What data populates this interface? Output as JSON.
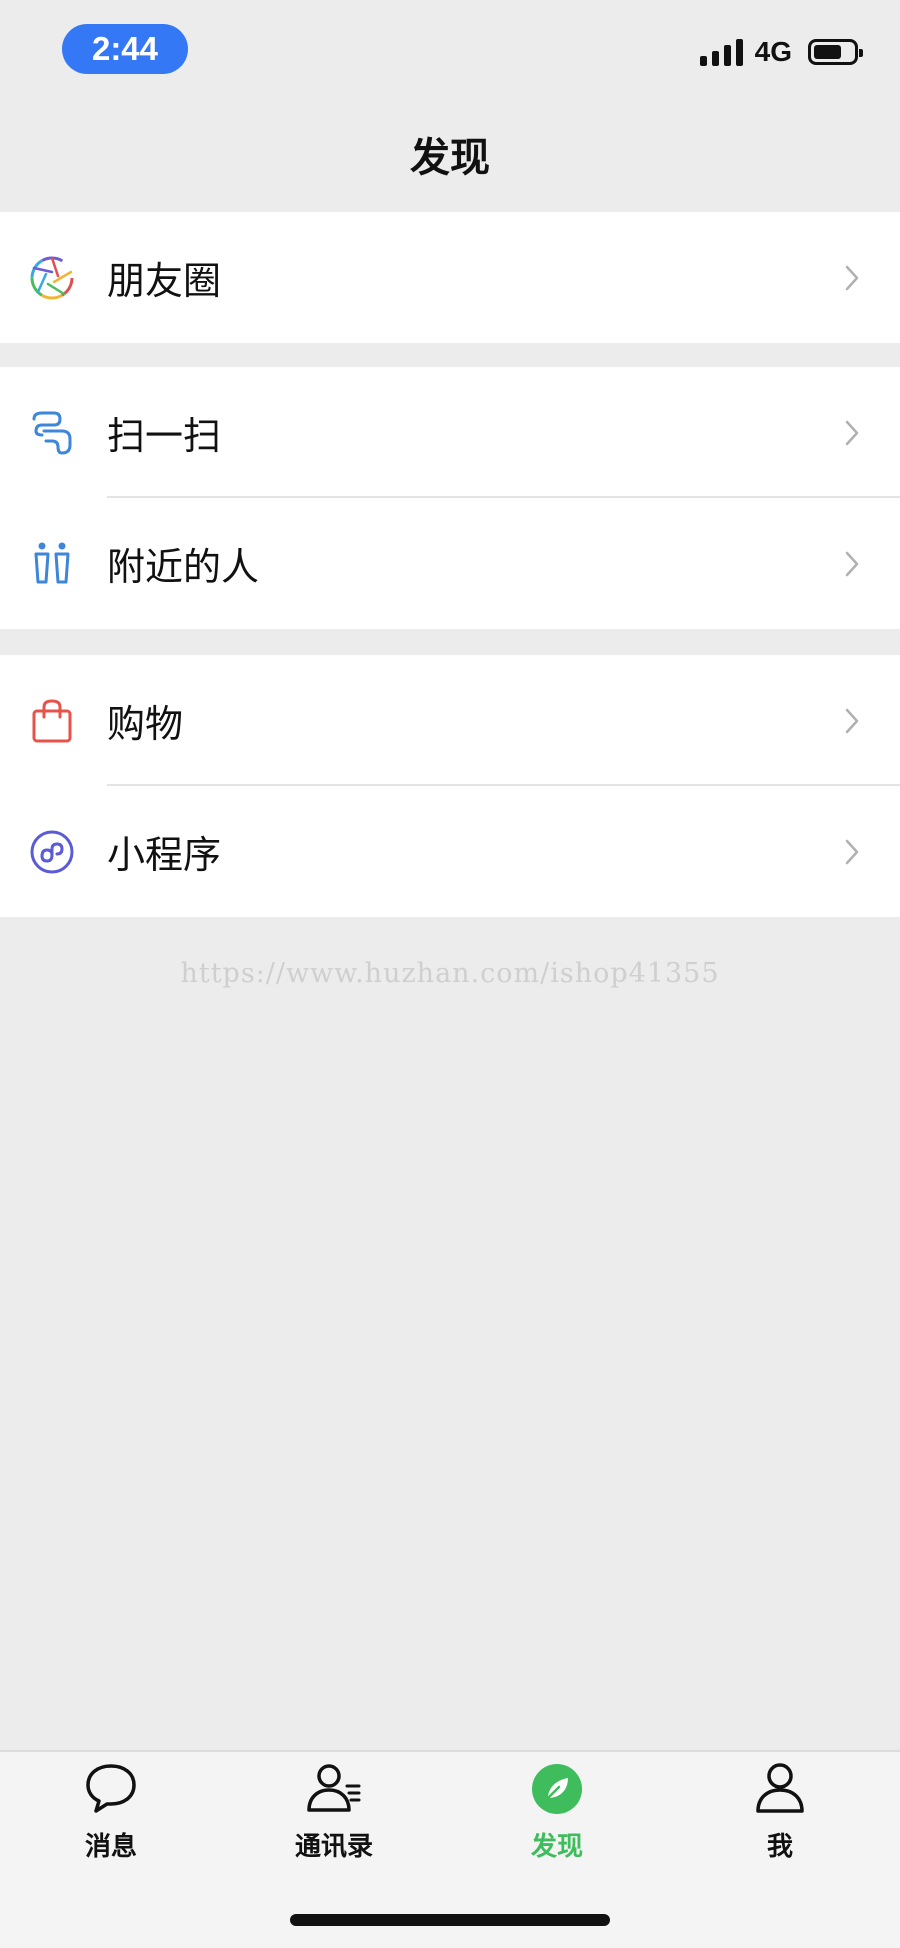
{
  "status": {
    "time": "2:44",
    "network": "4G",
    "battery_level": 0.7
  },
  "header": {
    "title": "发现"
  },
  "groups": [
    {
      "items": [
        {
          "label": "朋友圈",
          "icon": "moments-aperture-icon"
        }
      ]
    },
    {
      "items": [
        {
          "label": "扫一扫",
          "icon": "scan-icon"
        },
        {
          "label": "附近的人",
          "icon": "nearby-people-icon"
        }
      ]
    },
    {
      "items": [
        {
          "label": "购物",
          "icon": "shopping-bag-icon"
        },
        {
          "label": "小程序",
          "icon": "mini-program-icon"
        }
      ]
    }
  ],
  "watermark": "https://www.huzhan.com/ishop41355",
  "tabs": [
    {
      "label": "消息",
      "icon": "chat-bubble-icon",
      "active": false
    },
    {
      "label": "通讯录",
      "icon": "contacts-icon",
      "active": false
    },
    {
      "label": "发现",
      "icon": "compass-icon",
      "active": true
    },
    {
      "label": "我",
      "icon": "person-icon",
      "active": false
    }
  ],
  "colors": {
    "accent": "#3fbc5c",
    "time_pill": "#3478f6",
    "background": "#ececec"
  }
}
